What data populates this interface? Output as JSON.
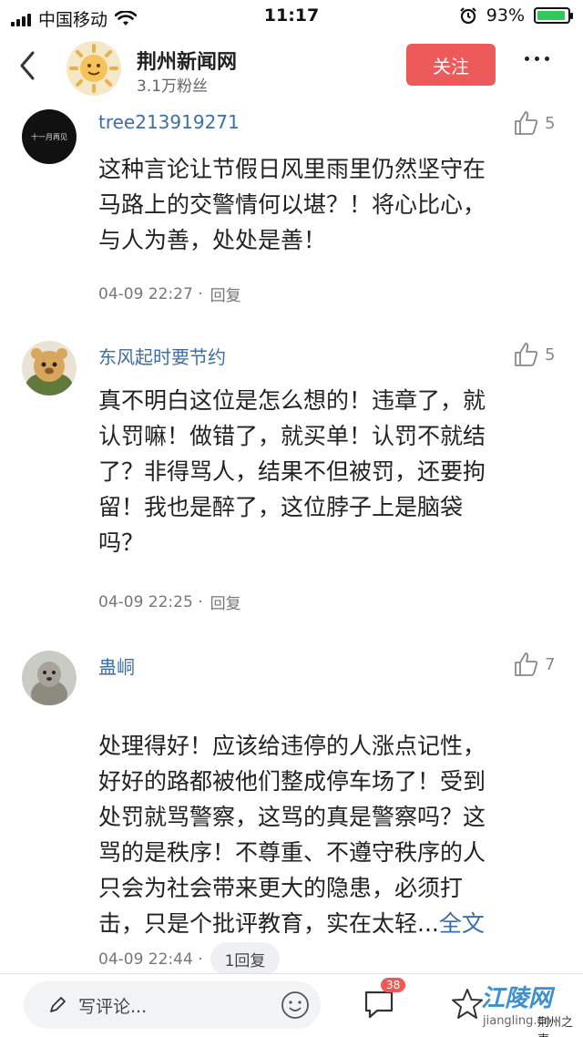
{
  "status_bar": {
    "carrier": "中国移动",
    "time": "11:17",
    "battery": "93%",
    "battery_level": 0.93
  },
  "header": {
    "account_name": "荆州新闻网",
    "followers": "3.1万粉丝",
    "follow_label": "关注"
  },
  "comments": [
    {
      "user": "tree213919271",
      "likes": "5",
      "text": "这种言论让节假日风里雨里仍然坚守在\n马路上的交警情何以堪？！将心比心，\n与人为善，处处是善！",
      "time": "04-09 22:27 · ",
      "reply": "回复",
      "avatar_text": "十一月再见"
    },
    {
      "user": "东风起时要节约",
      "likes": "5",
      "text": "真不明白这位是怎么想的！违章了，就\n认罚嘛！做错了，就买单！认罚不就结\n了？非得骂人，结果不但被罚，还要拘\n留！我也是醉了，这位脖子上是脑袋\n吗？",
      "time": "04-09 22:25 · ",
      "reply": "回复"
    },
    {
      "user": "蛊峒",
      "likes": "7",
      "text": "处理得好！应该给违停的人涨点记性，\n好好的路都被他们整成停车场了！受到\n处罚就骂警察，这骂的真是警察吗？这\n骂的是秩序！不尊重、不遵守秩序的人\n只会为社会带来更大的隐患，必须打\n击，只是个批评教育，实在太轻...",
      "fulltext": "全文",
      "time": "04-09 22:44 · ",
      "reply": "1回复"
    }
  ],
  "bottom_bar": {
    "write_placeholder": "写评论...",
    "comment_count": "38",
    "watermark_top": "江陵网",
    "watermark_url": "jiangling.cn",
    "watermark_brand": "荆州之声"
  }
}
